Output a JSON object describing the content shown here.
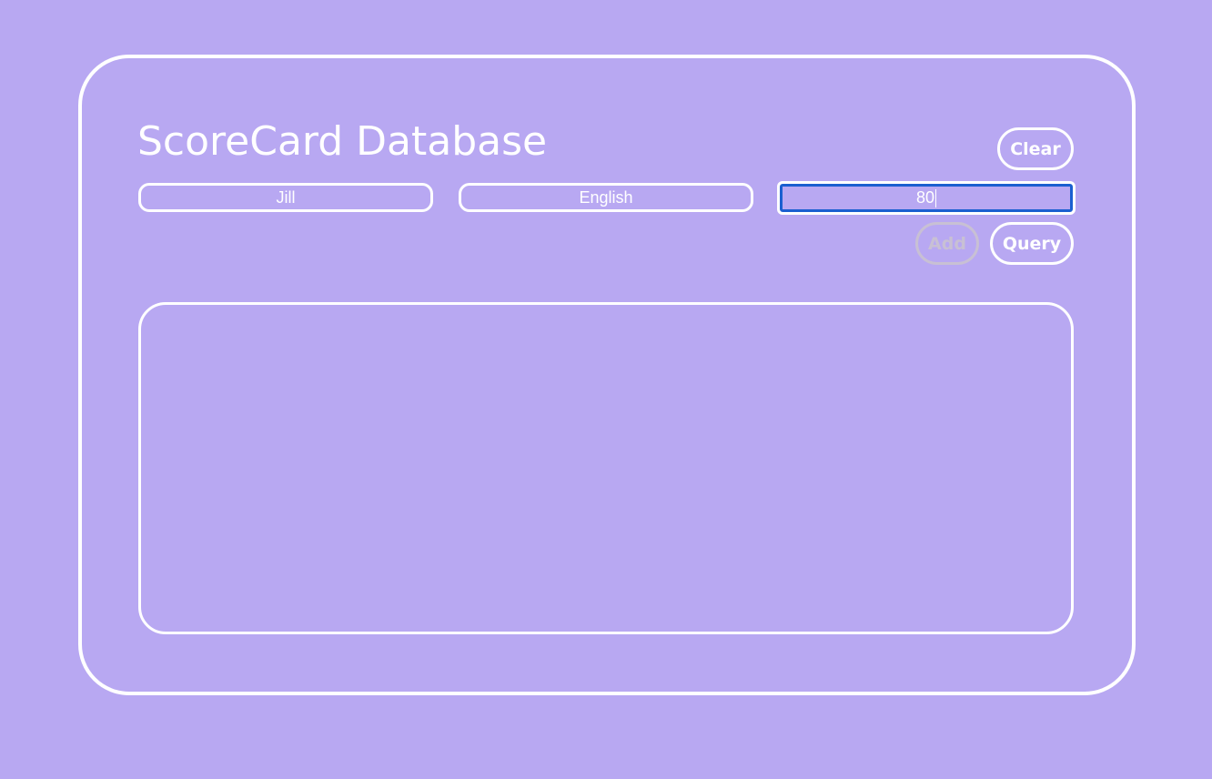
{
  "app": {
    "title": "ScoreCard Database"
  },
  "form": {
    "name_value": "Jill",
    "subject_value": "English",
    "score_value": "80"
  },
  "buttons": {
    "clear_label": "Clear",
    "add_label": "Add",
    "query_label": "Query"
  },
  "colors": {
    "background": "#b8a8f2",
    "foreground": "#ffffff",
    "focus_ring": "#1a5fd0",
    "disabled": "#c8c0d4"
  }
}
